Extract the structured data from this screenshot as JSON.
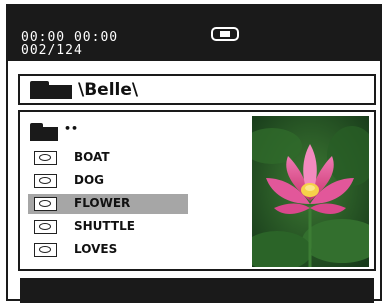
{
  "status": {
    "time": "00:00  00:00",
    "track_counter": "002/124",
    "mode_icon": "play-mode-icon"
  },
  "path": {
    "text": "\\Belle\\",
    "icon": "folder-icon"
  },
  "file_list": {
    "parent_label": "••",
    "parent_icon": "folder-icon",
    "items": [
      {
        "label": "BOAT",
        "icon": "disc-icon",
        "selected": false
      },
      {
        "label": "DOG",
        "icon": "disc-icon",
        "selected": false
      },
      {
        "label": "FLOWER",
        "icon": "disc-icon",
        "selected": true
      },
      {
        "label": "SHUTTLE",
        "icon": "disc-icon",
        "selected": false
      },
      {
        "label": "LOVES",
        "icon": "disc-icon",
        "selected": false
      }
    ]
  },
  "preview": {
    "subject": "pink-lotus-flower-thumbnail"
  },
  "colors": {
    "bar": "#1a1a1a",
    "highlight": "#a6a6a6",
    "petal": "#e8559a",
    "leaf": "#2e6b2a"
  }
}
